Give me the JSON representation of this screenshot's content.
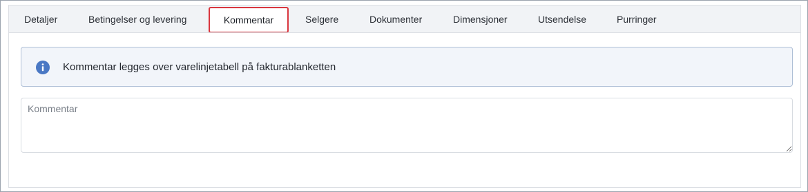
{
  "tabs": [
    {
      "label": "Detaljer"
    },
    {
      "label": "Betingelser og levering"
    },
    {
      "label": "Kommentar"
    },
    {
      "label": "Selgere"
    },
    {
      "label": "Dokumenter"
    },
    {
      "label": "Dimensjoner"
    },
    {
      "label": "Utsendelse"
    },
    {
      "label": "Purringer"
    }
  ],
  "active_tab": "Kommentar",
  "info": {
    "icon": "info-circle-icon",
    "text": "Kommentar legges over varelinjetabell på fakturablanketten",
    "icon_color": "#4a78c4"
  },
  "comment": {
    "value": "",
    "placeholder": "Kommentar"
  },
  "colors": {
    "active_tab_border": "#d9363e",
    "tabbar_bg": "#f1f3f6",
    "info_bg": "#f2f5fa"
  }
}
